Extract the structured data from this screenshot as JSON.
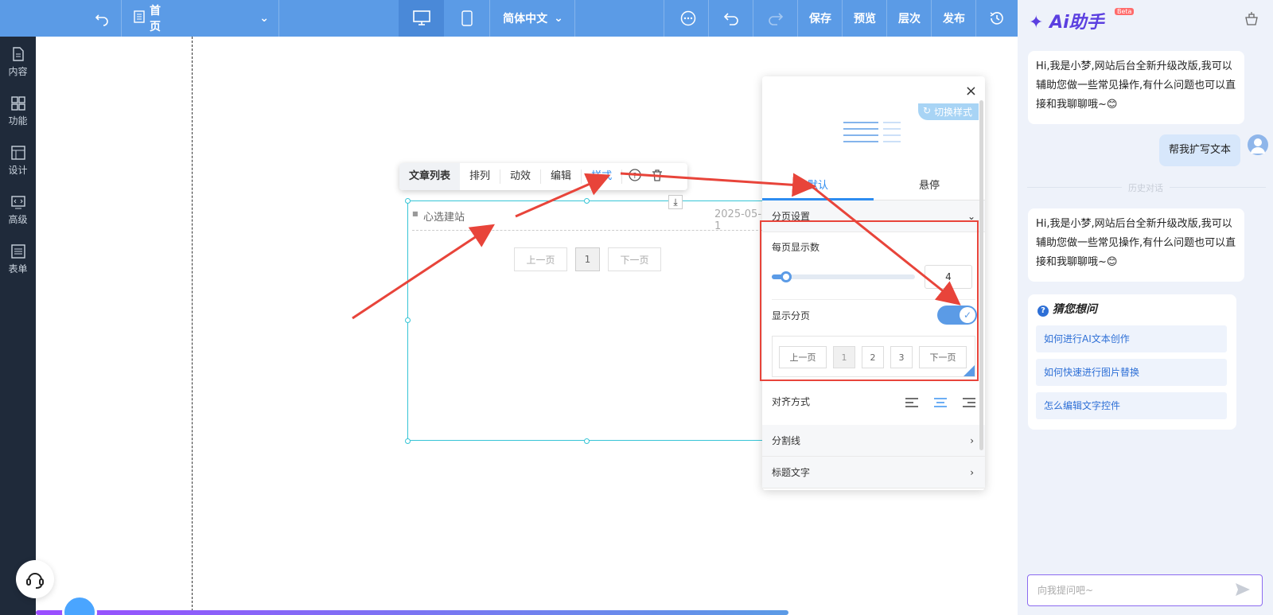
{
  "topbar": {
    "page_name": "首页",
    "language": "简体中文",
    "save": "保存",
    "preview": "预览",
    "layers": "层次",
    "publish": "发布"
  },
  "sidebar": {
    "items": [
      {
        "label": "内容",
        "icon": "document-icon"
      },
      {
        "label": "功能",
        "icon": "grid-icon"
      },
      {
        "label": "设计",
        "icon": "layout-icon"
      },
      {
        "label": "高级",
        "icon": "code-icon"
      },
      {
        "label": "表单",
        "icon": "form-icon"
      }
    ]
  },
  "toolbar": {
    "title": "文章列表",
    "arrange": "排列",
    "animation": "动效",
    "edit": "编辑",
    "style": "样式"
  },
  "article": {
    "title": "心选建站",
    "date": "2025-05-1",
    "prev": "上一页",
    "page": "1",
    "next": "下一页"
  },
  "panel": {
    "switch_style": "切换样式",
    "tab_default": "默认",
    "tab_hover": "悬停",
    "pagination_settings": "分页设置",
    "per_page_label": "每页显示数",
    "per_page_value": "4",
    "per_page_slider": 0.1,
    "show_pagination": "显示分页",
    "show_pagination_on": true,
    "preview_prev": "上一页",
    "preview_pages": [
      "1",
      "2",
      "3"
    ],
    "preview_next": "下一页",
    "align_label": "对齐方式",
    "align_selected": "center",
    "divider": "分割线",
    "title_text": "标题文字"
  },
  "ai": {
    "logo": "Ai助手",
    "beta": "Beta",
    "greeting": "Hi,我是小梦,网站后台全新升级改版,我可以辅助您做一些常见操作,有什么问题也可以直接和我聊聊哦~😊",
    "user_msg": "帮我扩写文本",
    "history_label": "历史对话",
    "greeting2": "Hi,我是小梦,网站后台全新升级改版,我可以辅助您做一些常见操作,有什么问题也可以直接和我聊聊哦~😊",
    "guess_title": "猜您想问",
    "guesses": [
      "如何进行AI文本创作",
      "如何快速进行图片替换",
      "怎么编辑文字控件"
    ],
    "input_placeholder": "向我提问吧~"
  },
  "colors": {
    "topbar": "#5b9be6",
    "sidebar": "#1f2a3a",
    "accent": "#2d8cf0",
    "highlight": "#e8443a"
  }
}
